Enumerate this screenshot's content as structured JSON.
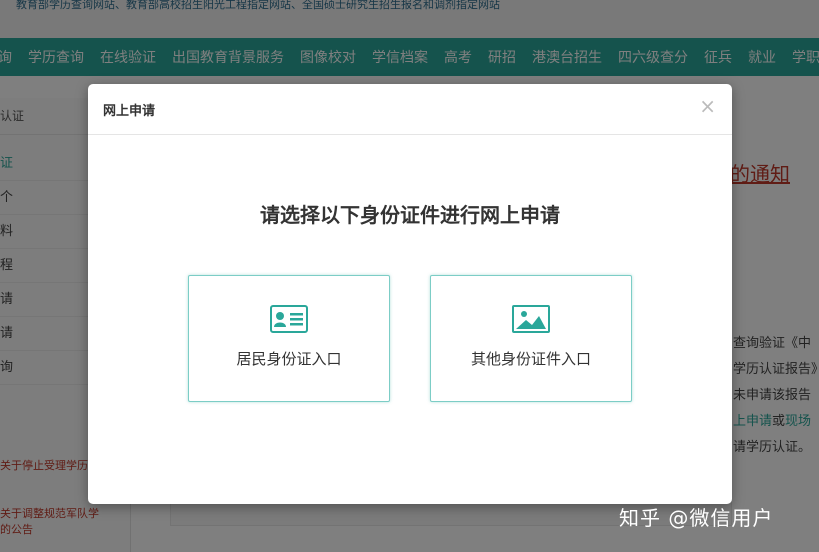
{
  "background": {
    "top_banner": "教育部学历查询网站、教育部高校招生阳光工程指定网站、全国硕士研究生招生报名和调剂指定网站",
    "nav_items": [
      "询",
      "学历查询",
      "在线验证",
      "出国教育背景服务",
      "图像校对",
      "学信档案",
      "高考",
      "研招",
      "港澳台招生",
      "四六级查分",
      "征兵",
      "就业",
      "学职平"
    ],
    "sidebar": {
      "header": "认证",
      "items": [
        "证",
        "个",
        "料",
        "程",
        "请",
        "请",
        "询"
      ],
      "links": [
        "关于停止受理学历",
        "关于调整规范军队学",
        "的公告"
      ]
    },
    "right": {
      "notice_title": "的通知",
      "lines": [
        "查询验证《中",
        "学历认证报告》",
        "未申请该报告",
        "请学历认证。"
      ],
      "apply_line": {
        "link1": "上申请",
        "mid": "或",
        "link2": "现场"
      }
    },
    "watermark": "知乎 @微信用户"
  },
  "modal": {
    "title": "网上申请",
    "close_symbol": "×",
    "heading": "请选择以下身份证件进行网上申请",
    "options": [
      {
        "label": "居民身份证入口",
        "icon": "id-card-icon"
      },
      {
        "label": "其他身份证件入口",
        "icon": "picture-icon"
      }
    ]
  },
  "colors": {
    "nav_bg": "#2aa79a",
    "accent": "#2aa79a",
    "option_border": "#7ccdc6",
    "link_red": "#c0392b",
    "overlay": "rgba(0,0,0,0.5)"
  }
}
